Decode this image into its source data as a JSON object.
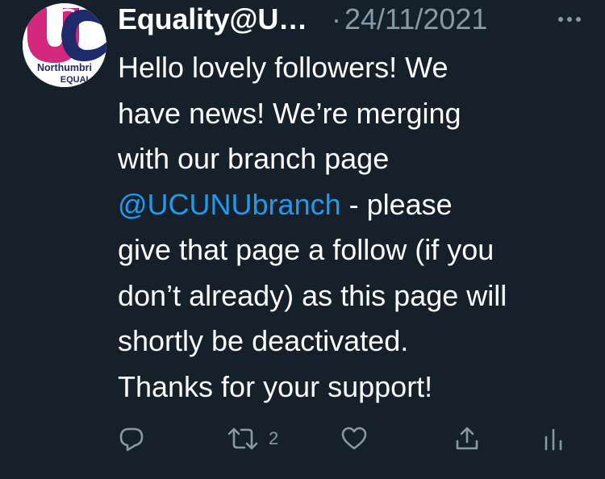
{
  "tweet": {
    "author": {
      "display_name": "Equality@U…",
      "avatar": {
        "logo_letters": "UC",
        "line1": "Northumbri",
        "line2": "EQUAL"
      }
    },
    "separator": "·",
    "timestamp": "24/11/2021",
    "body": {
      "line1": "Hello lovely followers! We",
      "line2": "have news! We’re merging",
      "line3": "with our branch page",
      "mention": "@UCUNUbranch",
      "line4_rest": " - please",
      "line5": "give that page a follow (if you",
      "line6": "don’t already) as this page will",
      "line7": "shortly be deactivated.",
      "line8": "Thanks for your support!"
    },
    "actions": {
      "reply": {
        "icon": "reply-icon"
      },
      "retweet": {
        "icon": "retweet-icon",
        "count": "2"
      },
      "like": {
        "icon": "heart-icon"
      },
      "share": {
        "icon": "share-icon"
      },
      "analytics": {
        "icon": "analytics-icon"
      }
    }
  },
  "colors": {
    "background": "#15202b",
    "text": "#ffffff",
    "secondary": "#8899a6",
    "link": "#1d9bf0",
    "brand_pink": "#d4287f",
    "brand_navy": "#1f2a6b"
  }
}
